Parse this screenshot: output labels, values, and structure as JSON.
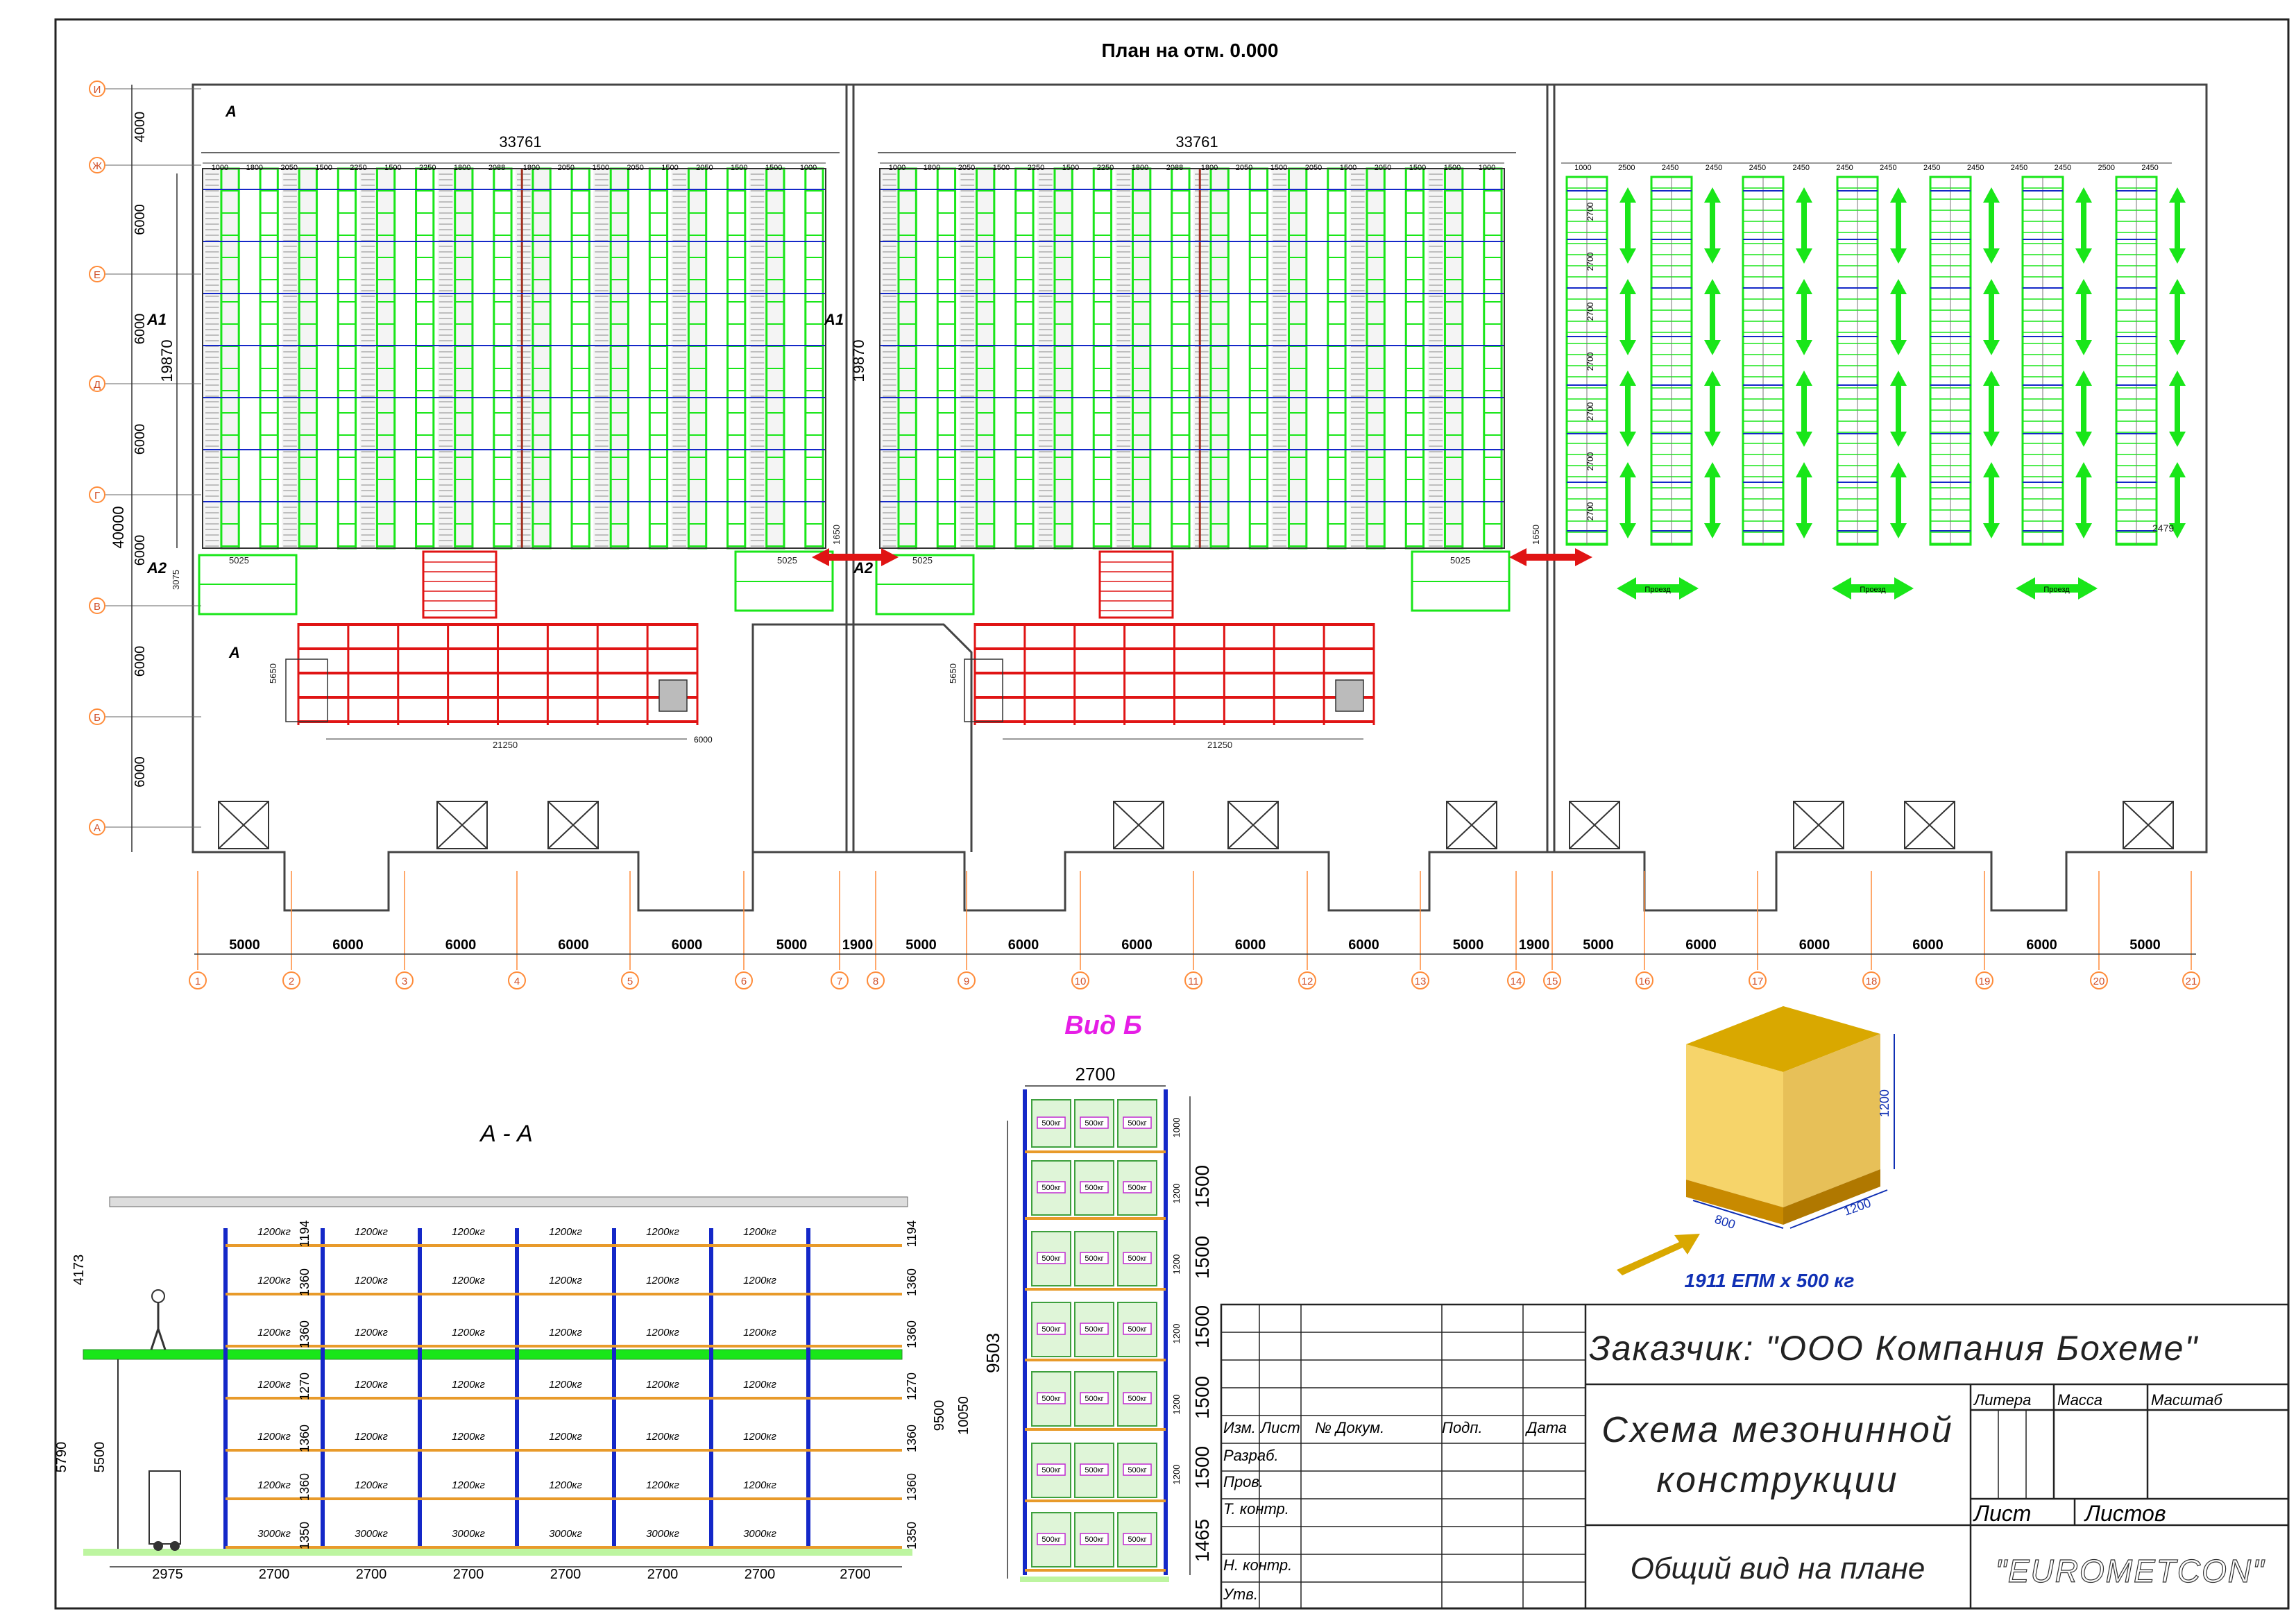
{
  "plan": {
    "title": "План на отм. 0.000",
    "row_axes": [
      "И",
      "Ж",
      "Е",
      "Д",
      "Г",
      "В",
      "Б",
      "А"
    ],
    "row_dims": [
      "4000",
      "6000",
      "6000",
      "6000",
      "6000",
      "6000",
      "6000"
    ],
    "col_axes": [
      "1",
      "2",
      "3",
      "4",
      "5",
      "6",
      "7",
      "8",
      "9",
      "10",
      "11",
      "12",
      "13",
      "14",
      "15",
      "16",
      "17",
      "18",
      "19",
      "20",
      "21"
    ],
    "col_dims": [
      "5000",
      "6000",
      "6000",
      "6000",
      "6000",
      "5000",
      "1900",
      "5000",
      "6000",
      "6000",
      "6000",
      "6000",
      "5000",
      "1900",
      "5000",
      "6000",
      "6000",
      "6000",
      "6000",
      "5000"
    ],
    "total_40000": "40000",
    "block_width": "33761",
    "block_depth": "19870",
    "rack_spacings": [
      "1000",
      "1800",
      "2050",
      "1500",
      "2250",
      "1500",
      "2250",
      "1800",
      "2088",
      "1800",
      "2050",
      "1500",
      "2050",
      "1500",
      "2050",
      "1500",
      "1500",
      "1000"
    ],
    "floor_rack_spacings": [
      "1000",
      "2500",
      "2450",
      "2450",
      "2450",
      "2450",
      "2450",
      "2450",
      "2450",
      "2450",
      "2450",
      "2450",
      "2500",
      "2450"
    ],
    "floor_rack_depths": [
      "2700",
      "2700",
      "2700",
      "2700",
      "2700",
      "2700",
      "2700"
    ],
    "dim_2479": "2479",
    "small_dims": {
      "d5025": "5025",
      "d3075": "3075",
      "d5650": "5650",
      "d6000": "6000",
      "d21250": "21250",
      "d1650": "1650"
    },
    "section_marks": {
      "a": "А",
      "a1": "А1",
      "a2": "А2"
    },
    "passage_label": "Проезд"
  },
  "section_aa": {
    "title": "А - А",
    "loads": [
      "1200кг",
      "1200кг",
      "1200кг",
      "1200кг",
      "1200кг",
      "1200кг",
      "3000кг"
    ],
    "level_dims": [
      "1194",
      "1360",
      "1360",
      "1270",
      "1360",
      "1360",
      "1350"
    ],
    "left_dims": [
      "4173",
      "5790",
      "5500"
    ],
    "right_dims": [
      "9500",
      "10050"
    ],
    "bottom_dims": [
      "2975",
      "2700",
      "2700",
      "2700",
      "2700",
      "2700",
      "2700",
      "2700"
    ]
  },
  "view_b": {
    "title": "Вид Б",
    "width_dim": "2700",
    "height_dim": "9503",
    "box_label": "500кг",
    "right_dims": [
      "1500",
      "1500",
      "1500",
      "1500",
      "1500",
      "1465"
    ],
    "small_dims": [
      "1000",
      "1200",
      "1200",
      "1200",
      "1200",
      "1200"
    ]
  },
  "pallet": {
    "caption": "1911 ЕПМ х 500 кг",
    "height": "1200",
    "width": "1200",
    "depth": "800"
  },
  "title_block": {
    "customer": "Заказчик: \"ООО Компания Бохеме\"",
    "title_line1": "Схема мезонинной",
    "title_line2": "конструкции",
    "subtitle": "Общий вид на плане",
    "company": "\"EUROMETCON\"",
    "col_izm": "Изм.",
    "col_list": "Лист",
    "col_doc": "№ Докум.",
    "col_sign": "Подп.",
    "col_date": "Дата",
    "razrab": "Разраб.",
    "prov": "Пров.",
    "tkontr": "Т. контр.",
    "nkontr": "Н. контр.",
    "utv": "Утв.",
    "litera": "Литера",
    "massa": "Масса",
    "masshtab": "Масштаб",
    "list_label": "Лист",
    "listov_label": "Листов"
  },
  "colors": {
    "grid_axis": "#ff8c3a",
    "rack_green": "#19e619",
    "rack_red": "#e01414",
    "rack_blue": "#1428c8",
    "rack_orange": "#e89a2a",
    "view_title": "#e61ee6",
    "pallet_caption": "#1030b4",
    "pallet_yellow": "#f6d46a"
  }
}
